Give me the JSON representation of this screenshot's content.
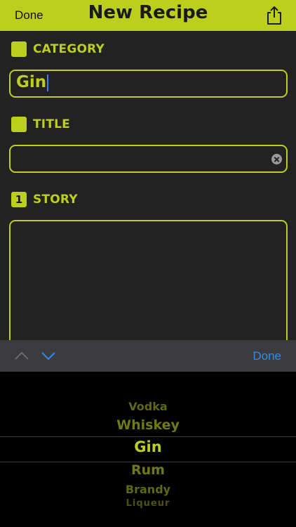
{
  "header": {
    "left_label": "Done",
    "title": "New Recipe",
    "share_icon": "share-icon"
  },
  "sections": {
    "category": {
      "label": "CATEGORY",
      "value": "Gin"
    },
    "title": {
      "label": "TITLE",
      "value": ""
    },
    "story": {
      "badge": "1",
      "label": "STORY",
      "value": ""
    }
  },
  "accessory": {
    "prev_icon": "chevron-up-icon",
    "next_icon": "chevron-down-icon",
    "done_label": "Done"
  },
  "picker": {
    "items": [
      "Vodka",
      "Whiskey",
      "Gin",
      "Rum",
      "Brandy",
      "Liqueur"
    ],
    "selected": "Gin"
  },
  "colors": {
    "accent": "#bccf1d",
    "background": "#222222",
    "link_blue": "#2d8cf0"
  }
}
